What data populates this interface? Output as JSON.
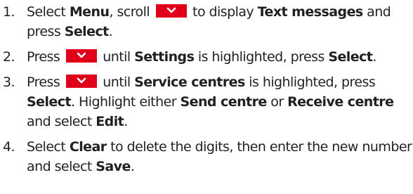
{
  "steps": [
    {
      "number": "1.",
      "parts": {
        "t1": "Select ",
        "b1": "Menu",
        "t2": ", scroll ",
        "t3": " to display ",
        "b2": "Text messages",
        "t4": " and press ",
        "b3": "Select",
        "t5": "."
      }
    },
    {
      "number": "2.",
      "parts": {
        "t1": "Press ",
        "t2": " until ",
        "b1": "Settings",
        "t3": " is highlighted, press ",
        "b2": "Select",
        "t4": "."
      }
    },
    {
      "number": "3.",
      "parts": {
        "t1": "Press ",
        "t2": " until ",
        "b1": "Service centres",
        "t3": " is highlighted, press ",
        "b2": "Select",
        "t4": ". Highlight either ",
        "b3": "Send centre",
        "t5": " or ",
        "b4": "Receive centre",
        "t6": " and select ",
        "b5": "Edit",
        "t7": "."
      }
    },
    {
      "number": "4.",
      "parts": {
        "t1": "Select ",
        "b1": "Clear",
        "t2": " to delete the digits, then enter the new number and select ",
        "b2": "Save",
        "t3": "."
      }
    }
  ],
  "icons": {
    "scroll_down_key": "chevron-down-icon",
    "key_color": "#e1001a",
    "chevron_color": "#ffffff"
  }
}
